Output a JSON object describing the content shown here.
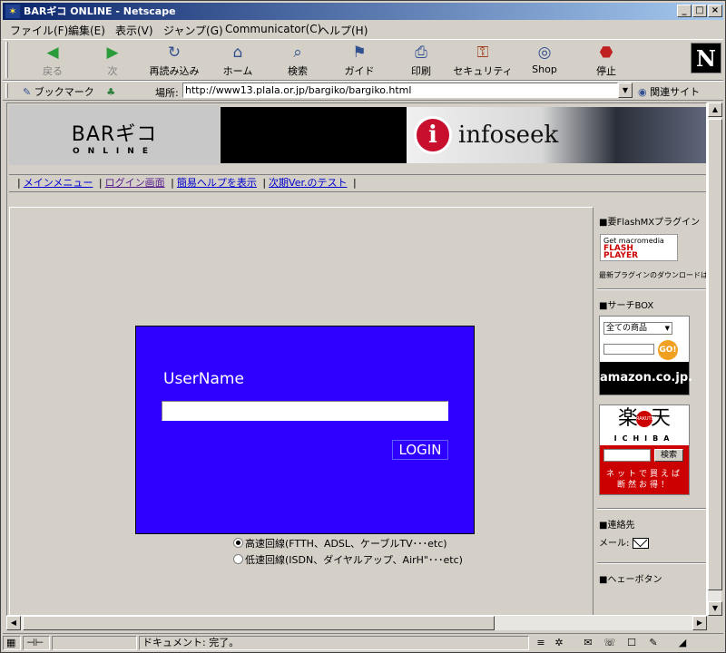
{
  "window": {
    "title": "BARギコ ONLINE - Netscape"
  },
  "menu": [
    "ファイル(F)",
    "編集(E)",
    "表示(V)",
    "ジャンプ(G)",
    "Communicator(C)",
    "ヘルプ(H)"
  ],
  "toolbar": {
    "buttons": [
      {
        "label": "戻る",
        "icon": "back-arrow-icon"
      },
      {
        "label": "次",
        "icon": "forward-arrow-icon"
      },
      {
        "label": "再読み込み",
        "icon": "reload-icon"
      },
      {
        "label": "ホーム",
        "icon": "home-icon"
      },
      {
        "label": "検索",
        "icon": "search-icon"
      },
      {
        "label": "ガイド",
        "icon": "guide-icon"
      },
      {
        "label": "印刷",
        "icon": "print-icon"
      },
      {
        "label": "セキュリティ",
        "icon": "lock-icon"
      },
      {
        "label": "Shop",
        "icon": "shop-icon"
      },
      {
        "label": "停止",
        "icon": "stop-icon"
      }
    ],
    "brand_letter": "N"
  },
  "location": {
    "bookmarks": "ブックマーク",
    "label": "場所:",
    "url": "http://www13.plala.or.jp/bargiko/bargiko.html",
    "related": "関連サイト"
  },
  "site": {
    "logo_main": "BARギコ",
    "logo_sub": "ONLINE",
    "banner_brand": "infoseek",
    "banner_letter": "i",
    "nav": [
      "メインメニュー",
      "ログイン画面",
      "簡易ヘルプを表示",
      "次期Ver.のテスト"
    ],
    "login": {
      "username_label": "UserName",
      "username_value": "",
      "button": "LOGIN"
    },
    "connection": [
      {
        "label": "高速回線(FTTH、ADSL、ケーブルTV･･･etc)",
        "checked": true
      },
      {
        "label": "低速回線(ISDN、ダイヤルアップ、AirH\"･･･etc)",
        "checked": false
      }
    ]
  },
  "sidebar": {
    "flash_heading": "■要FlashMXプラグイン",
    "flash_badge_line1": "Get macromedia",
    "flash_badge_line2": "FLASH",
    "flash_badge_line3": "PLAYER",
    "flash_note": "最新プラグインのダウンロードは",
    "search_heading": "■サーチBOX",
    "amazon_select": "全ての商品",
    "amazon_go": "GO!",
    "amazon_brand": "amazon.co.jp.",
    "rakuten_chars": "楽天",
    "rakuten_badge": "RAKUTEN",
    "rakuten_sub": "ICHIBA",
    "rakuten_search": "検索",
    "rakuten_tagline_1": "ネットで買えば",
    "rakuten_tagline_2": "断然お得！",
    "contact_heading": "■連絡先",
    "mail_label": "メール:",
    "hey_heading": "■ヘェーボタン"
  },
  "status": {
    "text": "ドキュメント: 完了。"
  }
}
